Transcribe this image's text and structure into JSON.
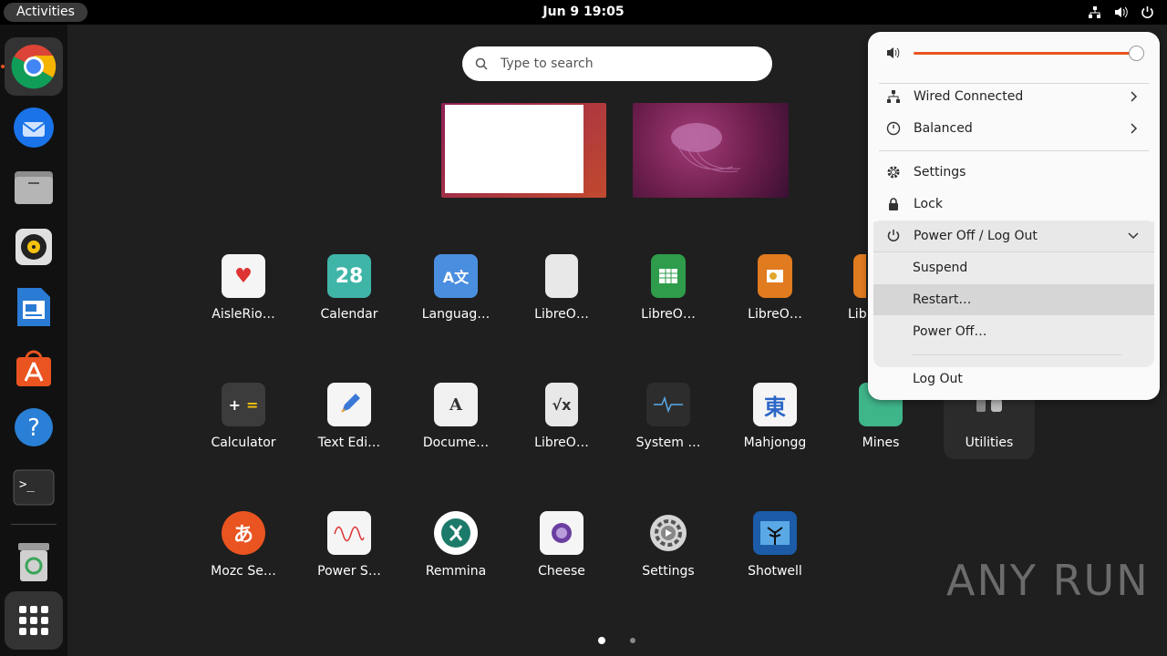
{
  "topbar": {
    "activities_label": "Activities",
    "clock": "Jun 9  19:05",
    "icons": [
      "network-icon",
      "volume-icon",
      "power-icon"
    ]
  },
  "dock": {
    "items": [
      {
        "name": "chrome",
        "icon": "chrome-icon",
        "active": true
      },
      {
        "name": "thunderbird",
        "icon": "thunderbird-icon"
      },
      {
        "name": "files",
        "icon": "files-icon"
      },
      {
        "name": "rhythmbox",
        "icon": "rhythmbox-icon"
      },
      {
        "name": "writer",
        "icon": "writer-icon"
      },
      {
        "name": "software",
        "icon": "software-icon"
      },
      {
        "name": "help",
        "icon": "help-icon"
      },
      {
        "name": "terminal",
        "icon": "terminal-icon"
      },
      {
        "name": "trash",
        "icon": "trash-icon"
      },
      {
        "name": "show-apps",
        "icon": "grid-icon"
      }
    ]
  },
  "search": {
    "placeholder": "Type to search"
  },
  "apps": {
    "row1": [
      "AisleRio…",
      "Calendar",
      "Languag…",
      "LibreO…",
      "LibreO…",
      "LibreO…",
      "Lib"
    ],
    "row2": [
      "Calculator",
      "Text Edi…",
      "Docume…",
      "LibreO…",
      "System …",
      "Mahjongg",
      "Mines",
      "Utilities"
    ],
    "row3": [
      "Mozc Se…",
      "Power S…",
      "Remmina",
      "Cheese",
      "Settings",
      "Shotwell"
    ],
    "calendar_day": "28",
    "mahjongg_glyph": "東"
  },
  "watermark": "ANY RUN",
  "menu": {
    "volume_level": 0.98,
    "wired": "Wired Connected",
    "power_mode": "Balanced",
    "settings": "Settings",
    "lock": "Lock",
    "power_section": "Power Off / Log Out",
    "suspend": "Suspend",
    "restart": "Restart…",
    "power_off": "Power Off…",
    "log_out": "Log Out"
  },
  "colors": {
    "accent": "#e95420",
    "menu_bg": "#fafafa",
    "dock_bg": "#111111"
  }
}
